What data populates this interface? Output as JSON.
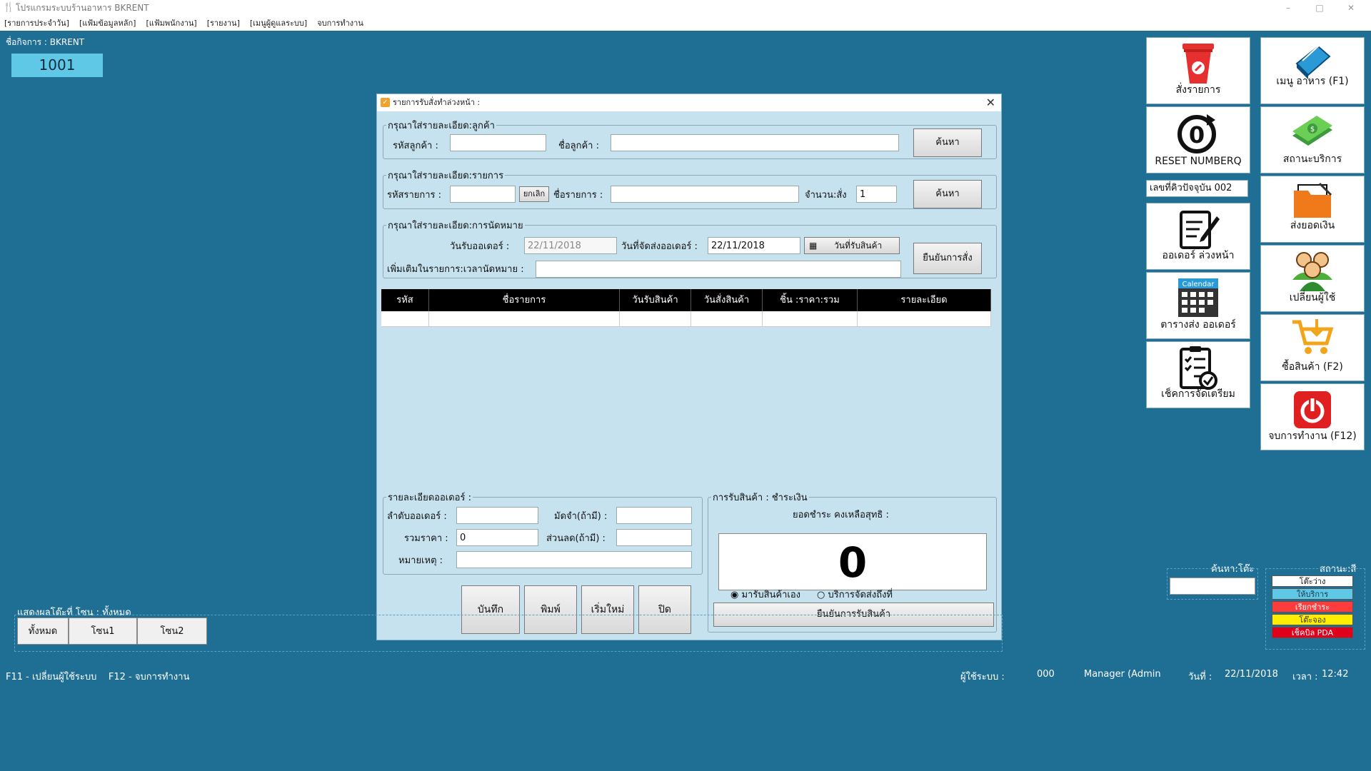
{
  "window": {
    "title": "โปรแกรมระบบร้านอาหาร  BKRENT",
    "minimize": "–",
    "maximize": "□",
    "close": "✕"
  },
  "menu": [
    "[รายการประจำวัน]",
    "[แฟ้มข้อมูลหลัก]",
    "[แฟ้มพนักงาน]",
    "[รายงาน]",
    "[เมนูผู้ดูแลระบบ]",
    "จบการทำงาน"
  ],
  "business": {
    "label": "ชื่อกิจการ :  BKRENT",
    "table_no": "1001"
  },
  "tiles": {
    "order": "สั่งรายการ",
    "food_menu": "เมนู อาหาร  (F1)",
    "reset": "RESET NUMBERQ",
    "service_status": "สถานะบริการ",
    "queue_now": "เลขที่คิวปัจจุบัน 002",
    "send_money": "ส่งยอดเงิน",
    "advance_order": "ออเดอร์ ล่วงหน้า",
    "change_user": "เปลี่ยนผู้ใช้",
    "calendar_badge": "Calendar",
    "delivery_schedule": "ตารางส่ง ออเดอร์",
    "buy_goods": "ซื้อสินค้า (F2)",
    "check_prep": "เช็คการจัดเตรียม",
    "exit": "จบการทำงาน (F12)"
  },
  "dialog": {
    "title": "รายการรับสั่งทำล่วงหน้า :",
    "close": "✕",
    "customer": {
      "legend": "กรุณาใส่รายละเอียด:ลูกค้า",
      "code_label": "รหัสลูกค้า :",
      "code_value": "",
      "name_label": "ชื่อลูกค้า :",
      "name_value": "",
      "search": "ค้นหา"
    },
    "item": {
      "legend": "กรุณาใส่รายละเอียด:รายการ",
      "code_label": "รหัสรายการ :",
      "code_value": "",
      "cancel": "ยกเลิก",
      "name_label": "ชื่อรายการ :",
      "name_value": "",
      "qty_label": "จำนวน:สั่ง",
      "qty_value": "1",
      "search": "ค้นหา"
    },
    "appointment": {
      "legend": "กรุณาใส่รายละเอียด:การนัดหมาย",
      "receive_label": "วันรับออเดอร์ :",
      "receive_value": "22/11/2018",
      "deliver_label": "วันที่จัดส่งออเดอร์ :",
      "deliver_value": "22/11/2018",
      "pickup_btn": "วันที่รับสินค้า",
      "confirm": "ยืนยันการสั่ง",
      "note_label": "เพิ่มเติมในรายการ:เวลานัดหมาย :",
      "note_value": ""
    },
    "grid": {
      "headers": [
        "รหัส",
        "ชื่อรายการ",
        "วันรับสินค้า",
        "วันสั่งสินค้า",
        "ชิ้น :ราคา:รวม",
        "รายละเอียด"
      ]
    },
    "order_detail": {
      "legend": "รายละเอียดออเดอร์ :",
      "seq_label": "ลำดับออเดอร์ :",
      "seq_value": "",
      "deposit_label": "มัดจำ(ถ้ามี) :",
      "deposit_value": "",
      "total_label": "รวมราคา :",
      "total_value": "0",
      "discount_label": "ส่วนลด(ถ้ามี) :",
      "discount_value": "",
      "remark_label": "หมายเหตุ :",
      "remark_value": ""
    },
    "buttons": {
      "save": "บันทึก",
      "print": "พิมพ์",
      "reset": "เริ่มใหม่",
      "close": "ปิด"
    },
    "payment": {
      "legend": "การรับสินค้า : ชำระเงิน",
      "balance_label": "ยอดชำระ คงเหลือสุทธิ :",
      "balance_value": "0",
      "opt_pickup": "มารับสินค้าเอง",
      "opt_delivery": "บริการจัดส่งถึงที่",
      "confirm": "ยืนยันการรับสินค้า"
    }
  },
  "zones": {
    "caption": "แสดงผลโต๊ะที่  โซน : ทั้งหมด",
    "buttons": [
      "ทั้งหมด",
      "โซน1",
      "โซน2"
    ]
  },
  "table_search": {
    "label": "ค้นหา:โต๊ะ"
  },
  "status_legend": {
    "label": "สถานะ:สี",
    "items": [
      {
        "text": "โต๊ะว่าง",
        "bg": "#ffffff",
        "fg": "#111111"
      },
      {
        "text": "ให้บริการ",
        "bg": "#5ec8e6",
        "fg": "#1a3a4a"
      },
      {
        "text": "เรียกชำระ",
        "bg": "#ff3b3b",
        "fg": "#ffffff"
      },
      {
        "text": "โต๊ะจอง",
        "bg": "#ffee00",
        "fg": "#333333"
      },
      {
        "text": "เช็คบิล PDA",
        "bg": "#e0001b",
        "fg": "#ffffff"
      }
    ]
  },
  "footer": {
    "shortcuts": "F11 - เปลี่ยนผู้ใช้ระบบ    F12 - จบการทำงาน",
    "user_label": "ผู้ใช้ระบบ :",
    "user_code": "000",
    "user_name": "Manager (Admin",
    "date_label": "วันที่ :",
    "date_value": "22/11/2018",
    "time_label": "เวลา :",
    "time_value": "12:42"
  }
}
